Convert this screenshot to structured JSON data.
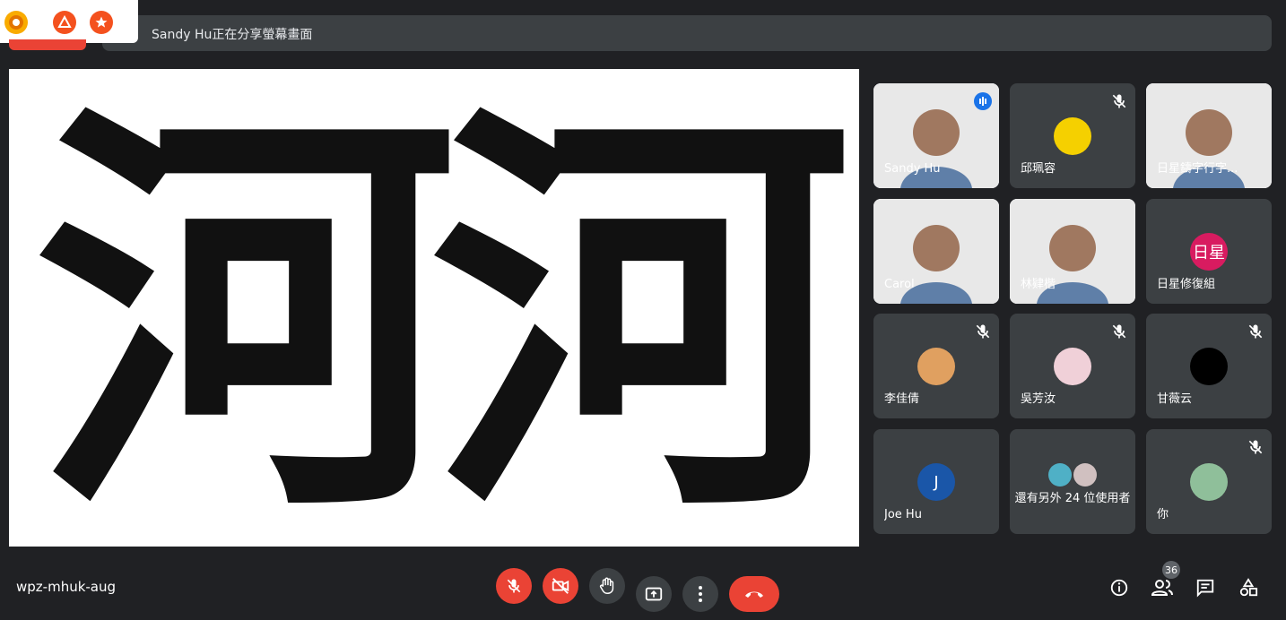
{
  "banner": {
    "text": "Sandy Hu正在分享螢幕畫面"
  },
  "extensions": [
    "meet-extension-icon",
    "triangle-logo-icon",
    "star-badge-icon"
  ],
  "presentation": {
    "glyphs": [
      "河",
      "河"
    ]
  },
  "participants": [
    {
      "name": "Sandy Hu",
      "type": "video",
      "active": true,
      "speaking": true
    },
    {
      "name": "邱珮容",
      "type": "avatar",
      "muted": true,
      "avatar_color": "#f5d000"
    },
    {
      "name": "日星鑄字行字...",
      "type": "video",
      "muted": false
    },
    {
      "name": "Carol",
      "type": "video"
    },
    {
      "name": "林肄楷",
      "type": "video"
    },
    {
      "name": "日星修復組",
      "type": "initial",
      "initial": "日星",
      "avatar_color": "#d81b60"
    },
    {
      "name": "李佳倩",
      "type": "avatar",
      "muted": true,
      "avatar_color": "#e0a060"
    },
    {
      "name": "吳芳汝",
      "type": "avatar",
      "muted": true,
      "avatar_color": "#f0d0d8"
    },
    {
      "name": "甘薇云",
      "type": "avatar",
      "muted": true,
      "avatar_color": "#000000"
    },
    {
      "name": "Joe Hu",
      "type": "initial",
      "initial": "J",
      "avatar_color": "#1a56a8"
    },
    {
      "name": "還有另外 24 位使用者",
      "type": "others"
    },
    {
      "name": "你",
      "type": "avatar",
      "muted": true,
      "avatar_color": "#8fbf9a"
    }
  ],
  "bottom": {
    "meeting_code": "wpz-mhuk-aug",
    "people_count": "36"
  },
  "colors": {
    "danger": "#ea4335",
    "surface": "#3c4043",
    "background": "#202124",
    "accent": "#8ab4f8"
  }
}
